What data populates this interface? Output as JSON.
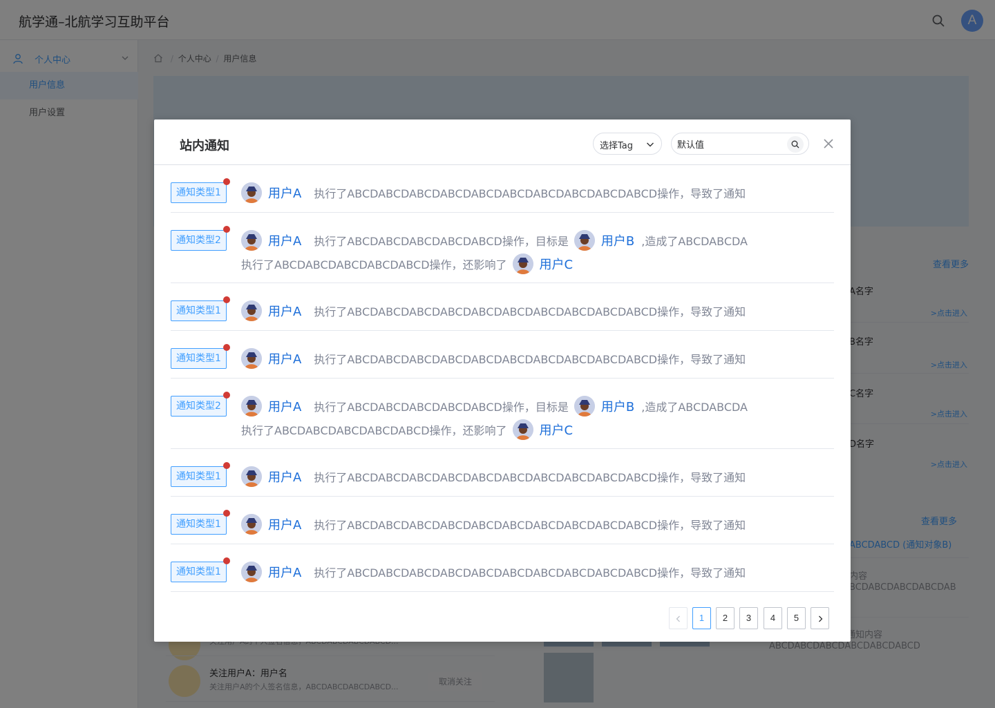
{
  "app": {
    "title": "航学通–北航学习互助平台",
    "avatar_letter": "A"
  },
  "sidebar": {
    "group_label": "个人中心",
    "items": [
      {
        "label": "用户信息",
        "active": true
      },
      {
        "label": "用户设置",
        "active": false
      }
    ]
  },
  "breadcrumb": {
    "items": [
      "个人中心",
      "用户信息"
    ]
  },
  "right_panel": {
    "more1": "查看更多",
    "entries": [
      {
        "name": "A名字",
        "link": ">点击进入"
      },
      {
        "name": "B名字",
        "link": ">点击进入"
      },
      {
        "name": "C名字",
        "link": ">点击进入"
      },
      {
        "name": "D名字",
        "link": ">点击进入"
      }
    ],
    "more2": "查看更多",
    "notice_line": "ABCDABCD (通知对象B)",
    "notice_line2": "内容",
    "notice_line3": "BCDABCDABCDABCDAB",
    "notice_line4": "通知内容",
    "notice_line5": "ABCDABCDABCDABCDABCDABCD"
  },
  "bottom": {
    "follow_name": "关注用户A：用户名",
    "follow_desc": "关注用户A的个人签名信息，ABCDABCDABCDABCD...",
    "follow_desc_top": "关注用户A的个人签名信息，ABCDABCDABCDABCD...",
    "follow_button": "取消关注"
  },
  "dialog": {
    "title": "站内通知",
    "tag_select_value": "选择Tag",
    "search_value": "默认值",
    "notices": [
      {
        "tag": "通知类型1",
        "kind": "single",
        "user": "用户A",
        "text": "执行了ABCDABCDABCDABCDABCDABCDABCDABCDABCDABCD操作，导致了通知"
      },
      {
        "tag": "通知类型2",
        "kind": "double",
        "user": "用户A",
        "text1": "执行了ABCDABCDABCDABCDABCD操作，目标是",
        "user2": "用户B",
        "text2": ",造成了ABCDABCDA",
        "text3": "执行了ABCDABCDABCDABCDABCD操作，还影响了",
        "user3": "用户C"
      },
      {
        "tag": "通知类型1",
        "kind": "single",
        "user": "用户A",
        "text": "执行了ABCDABCDABCDABCDABCDABCDABCDABCDABCDABCD操作，导致了通知"
      },
      {
        "tag": "通知类型1",
        "kind": "single",
        "user": "用户A",
        "text": "执行了ABCDABCDABCDABCDABCDABCDABCDABCDABCDABCD操作，导致了通知"
      },
      {
        "tag": "通知类型2",
        "kind": "double",
        "user": "用户A",
        "text1": "执行了ABCDABCDABCDABCDABCD操作，目标是",
        "user2": "用户B",
        "text2": ",造成了ABCDABCDA",
        "text3": "执行了ABCDABCDABCDABCDABCD操作，还影响了",
        "user3": "用户C"
      },
      {
        "tag": "通知类型1",
        "kind": "single",
        "user": "用户A",
        "text": "执行了ABCDABCDABCDABCDABCDABCDABCDABCDABCDABCD操作，导致了通知"
      },
      {
        "tag": "通知类型1",
        "kind": "single",
        "user": "用户A",
        "text": "执行了ABCDABCDABCDABCDABCDABCDABCDABCDABCDABCD操作，导致了通知"
      },
      {
        "tag": "通知类型1",
        "kind": "single",
        "user": "用户A",
        "text": "执行了ABCDABCDABCDABCDABCDABCDABCDABCDABCDABCD操作，导致了通知"
      }
    ],
    "pagination": {
      "pages": [
        "1",
        "2",
        "3",
        "4",
        "5"
      ],
      "current": "1"
    }
  },
  "colors": {
    "accent": "#409eff",
    "username": "#1e6fd9",
    "unread_dot": "#d13b35",
    "mask": "rgba(0,0,0,0.5)"
  },
  "icons": [
    "search-icon",
    "user-icon",
    "chevron-down-icon",
    "home-icon",
    "close-icon",
    "chevron-left-icon",
    "chevron-right-icon"
  ]
}
